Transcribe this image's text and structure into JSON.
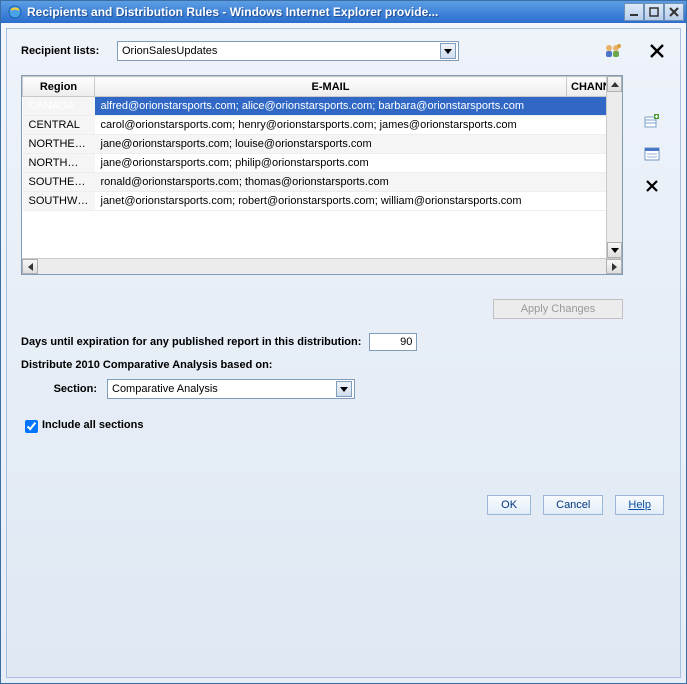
{
  "window": {
    "title": "Recipients and Distribution Rules - Windows Internet Explorer provide..."
  },
  "header": {
    "recipient_lists_label": "Recipient lists:",
    "selected_list": "OrionSalesUpdates"
  },
  "grid": {
    "columns": {
      "region": "Region",
      "email": "E-MAIL",
      "channel": "CHANNE"
    },
    "rows": [
      {
        "region": "CANADA",
        "email": "alfred@orionstarsports.com; alice@orionstarsports.com; barbara@orionstarsports.com",
        "selected": true
      },
      {
        "region": "CENTRAL",
        "email": "carol@orionstarsports.com; henry@orionstarsports.com; james@orionstarsports.com"
      },
      {
        "region": "NORTHEAST",
        "email": "jane@orionstarsports.com; louise@orionstarsports.com"
      },
      {
        "region": "NORTHWEST",
        "email": "jane@orionstarsports.com; philip@orionstarsports.com"
      },
      {
        "region": "SOUTHEAST",
        "email": "ronald@orionstarsports.com; thomas@orionstarsports.com"
      },
      {
        "region": "SOUTHWEST",
        "email": "janet@orionstarsports.com; robert@orionstarsports.com; william@orionstarsports.com"
      }
    ]
  },
  "apply_changes_label": "Apply Changes",
  "form": {
    "days_label": "Days until expiration for any published report in this distribution:",
    "days_value": "90",
    "distribute_label": "Distribute 2010 Comparative Analysis based on:",
    "section_label": "Section:",
    "section_value": "Comparative Analysis",
    "include_all_label": "Include all sections",
    "include_all_checked": true
  },
  "buttons": {
    "ok": "OK",
    "cancel": "Cancel",
    "help": "Help"
  },
  "icons": {
    "ie": "ie-icon",
    "minimize": "_",
    "maximize": "□",
    "close": "×",
    "users": "users-icon",
    "delete_big": "✕",
    "add_list": "add-list-icon",
    "props": "properties-icon",
    "delete_row": "✕"
  }
}
